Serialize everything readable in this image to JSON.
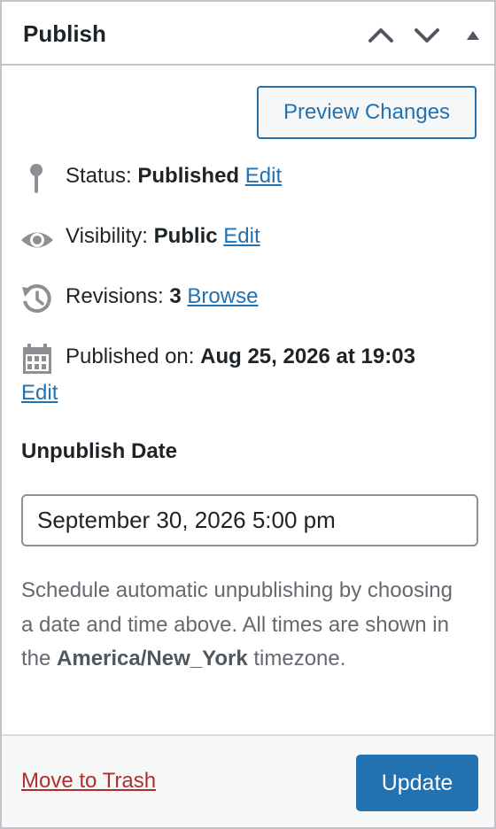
{
  "panel": {
    "title": "Publish",
    "preview_label": "Preview Changes"
  },
  "status": {
    "label": "Status:",
    "value": "Published",
    "edit": "Edit"
  },
  "visibility": {
    "label": "Visibility:",
    "value": "Public",
    "edit": "Edit"
  },
  "revisions": {
    "label": "Revisions:",
    "value": "3",
    "browse": "Browse"
  },
  "published_on": {
    "label": "Published on:",
    "value": "Aug 25, 2026 at 19:03",
    "edit": "Edit"
  },
  "unpublish": {
    "label": "Unpublish Date",
    "value": "September 30, 2026 5:00 pm",
    "help_before": "Schedule automatic unpublishing by choosing a date and time above. All times are shown in the ",
    "timezone": "America/New_York",
    "help_after": " timezone."
  },
  "footer": {
    "trash": "Move to Trash",
    "update": "Update"
  },
  "colors": {
    "accent": "#2271b1",
    "trash": "#b32d2e",
    "text": "#1d2327",
    "muted": "#646970",
    "icon": "#8c8f94"
  },
  "icons": [
    "chevron-up-icon",
    "chevron-down-icon",
    "triangle-up-icon",
    "pin-icon",
    "eye-icon",
    "history-icon",
    "calendar-icon"
  ]
}
